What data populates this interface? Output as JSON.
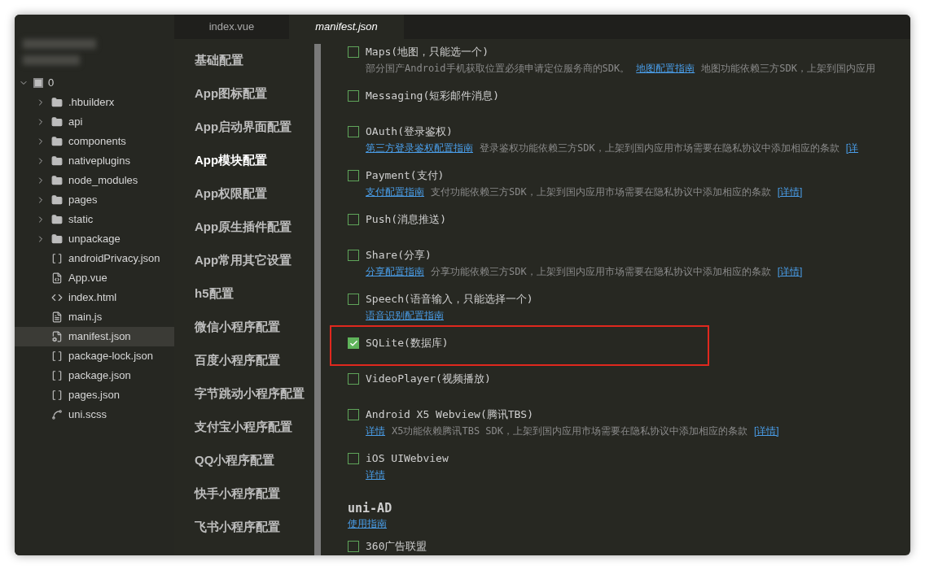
{
  "explorer": {
    "project": {
      "name": "0",
      "expanded": true,
      "children": [
        {
          "name": ".hbuilderx",
          "kind": "folder",
          "selected": false
        },
        {
          "name": "api",
          "kind": "folder",
          "selected": false
        },
        {
          "name": "components",
          "kind": "folder",
          "selected": false
        },
        {
          "name": "nativeplugins",
          "kind": "folder",
          "selected": false
        },
        {
          "name": "node_modules",
          "kind": "folder",
          "selected": false
        },
        {
          "name": "pages",
          "kind": "folder",
          "selected": false
        },
        {
          "name": "static",
          "kind": "folder",
          "selected": false
        },
        {
          "name": "unpackage",
          "kind": "folder",
          "selected": false
        },
        {
          "name": "androidPrivacy.json",
          "kind": "json",
          "selected": false
        },
        {
          "name": "App.vue",
          "kind": "vue",
          "selected": false
        },
        {
          "name": "index.html",
          "kind": "html",
          "selected": false
        },
        {
          "name": "main.js",
          "kind": "js",
          "selected": false
        },
        {
          "name": "manifest.json",
          "kind": "manifest",
          "selected": true
        },
        {
          "name": "package-lock.json",
          "kind": "json",
          "selected": false
        },
        {
          "name": "package.json",
          "kind": "json",
          "selected": false
        },
        {
          "name": "pages.json",
          "kind": "json",
          "selected": false
        },
        {
          "name": "uni.scss",
          "kind": "scss",
          "selected": false
        }
      ]
    }
  },
  "tabs": [
    {
      "label": "index.vue",
      "selected": false
    },
    {
      "label": "manifest.json",
      "selected": true
    }
  ],
  "nav": [
    {
      "label": "基础配置",
      "selected": false
    },
    {
      "label": "App图标配置",
      "selected": false
    },
    {
      "label": "App启动界面配置",
      "selected": false
    },
    {
      "label": "App模块配置",
      "selected": true
    },
    {
      "label": "App权限配置",
      "selected": false
    },
    {
      "label": "App原生插件配置",
      "selected": false
    },
    {
      "label": "App常用其它设置",
      "selected": false
    },
    {
      "label": "h5配置",
      "selected": false
    },
    {
      "label": "微信小程序配置",
      "selected": false
    },
    {
      "label": "百度小程序配置",
      "selected": false
    },
    {
      "label": "字节跳动小程序配置",
      "selected": false
    },
    {
      "label": "支付宝小程序配置",
      "selected": false
    },
    {
      "label": "QQ小程序配置",
      "selected": false
    },
    {
      "label": "快手小程序配置",
      "selected": false
    },
    {
      "label": "飞书小程序配置",
      "selected": false
    }
  ],
  "modules": [
    {
      "label": "Maps(地图，只能选一个)",
      "checked": false,
      "highlighted": false,
      "description": [
        {
          "kind": "text",
          "text": "部分国产Android手机获取位置必须申请定位服务商的SDK。"
        },
        {
          "kind": "link",
          "text": "地图配置指南"
        },
        {
          "kind": "text",
          "text": "地图功能依赖三方SDK，上架到国内应用"
        }
      ]
    },
    {
      "label": "Messaging(短彩邮件消息)",
      "checked": false,
      "highlighted": false
    },
    {
      "label": "OAuth(登录鉴权)",
      "checked": false,
      "highlighted": false,
      "description": [
        {
          "kind": "link",
          "text": "第三方登录鉴权配置指南"
        },
        {
          "kind": "text",
          "text": "登录鉴权功能依赖三方SDK，上架到国内应用市场需要在隐私协议中添加相应的条款"
        },
        {
          "kind": "link",
          "text": "[详"
        }
      ]
    },
    {
      "label": "Payment(支付)",
      "checked": false,
      "highlighted": false,
      "description": [
        {
          "kind": "link",
          "text": "支付配置指南"
        },
        {
          "kind": "text",
          "text": "支付功能依赖三方SDK，上架到国内应用市场需要在隐私协议中添加相应的条款"
        },
        {
          "kind": "link",
          "text": "[详情]"
        }
      ]
    },
    {
      "label": "Push(消息推送)",
      "checked": false,
      "highlighted": false
    },
    {
      "label": "Share(分享)",
      "checked": false,
      "highlighted": false,
      "description": [
        {
          "kind": "link",
          "text": "分享配置指南"
        },
        {
          "kind": "text",
          "text": "分享功能依赖三方SDK，上架到国内应用市场需要在隐私协议中添加相应的条款"
        },
        {
          "kind": "link",
          "text": "[详情]"
        }
      ]
    },
    {
      "label": "Speech(语音输入，只能选择一个)",
      "checked": false,
      "highlighted": false,
      "description": [
        {
          "kind": "link",
          "text": "语音识别配置指南"
        }
      ]
    },
    {
      "label": "SQLite(数据库)",
      "checked": true,
      "highlighted": true
    },
    {
      "label": "VideoPlayer(视频播放)",
      "checked": false,
      "highlighted": false
    },
    {
      "label": "Android X5 Webview(腾讯TBS)",
      "checked": false,
      "highlighted": false,
      "description": [
        {
          "kind": "link",
          "text": "详情"
        },
        {
          "kind": "text",
          "text": "X5功能依赖腾讯TBS SDK，上架到国内应用市场需要在隐私协议中添加相应的条款"
        },
        {
          "kind": "link",
          "text": "[详情]"
        }
      ]
    },
    {
      "label": "iOS UIWebview",
      "checked": false,
      "highlighted": false,
      "description": [
        {
          "kind": "link",
          "text": "详情"
        }
      ]
    }
  ],
  "ad_section": {
    "title": "uni-AD",
    "link": "使用指南",
    "items": [
      {
        "label": "360广告联盟",
        "checked": false
      }
    ]
  }
}
